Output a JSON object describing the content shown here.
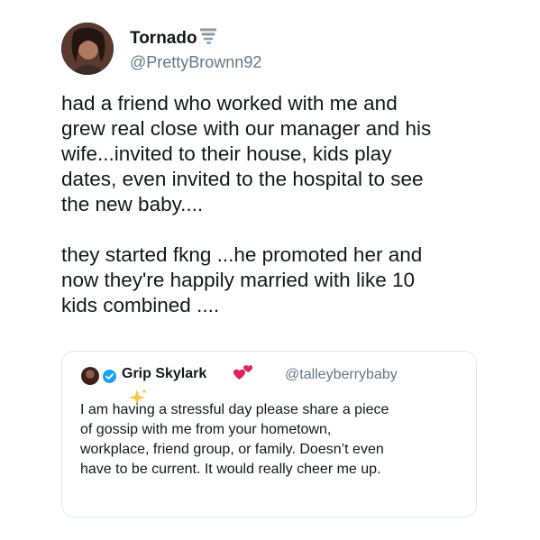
{
  "tweet": {
    "display_name": "Tornado",
    "name_emoji": "tornado-icon",
    "handle": "@PrettyBrownn92",
    "body_lines": [
      "had a friend who worked with me and",
      "grew real close with our manager and his",
      "wife...invited to their house, kids play",
      "dates, even invited to the hospital to see",
      "the new baby....",
      "",
      "they started fkng ...he promoted her and",
      "now they're happily married  with like 10",
      "kids combined ...."
    ]
  },
  "quote": {
    "display_name": "Grip Skylark",
    "verified_icon": "verified-badge-icon",
    "name_emoji": "two-hearts-icon",
    "handle": "@talleyberrybaby",
    "body_lines": [
      "I am having a stressful day please share a piece",
      "of gossip with me from your hometown,",
      "workplace, friend group, or family. Doesn’t even",
      "have to be current. It would really cheer me up."
    ],
    "overlay_emoji": "sparkles-icon"
  },
  "colors": {
    "text": "#14171a",
    "secondary": "#657786",
    "border": "#e1e8ed",
    "verified": "#1da1f2",
    "heart": "#e0245e",
    "sparkle": "#f4c542"
  }
}
